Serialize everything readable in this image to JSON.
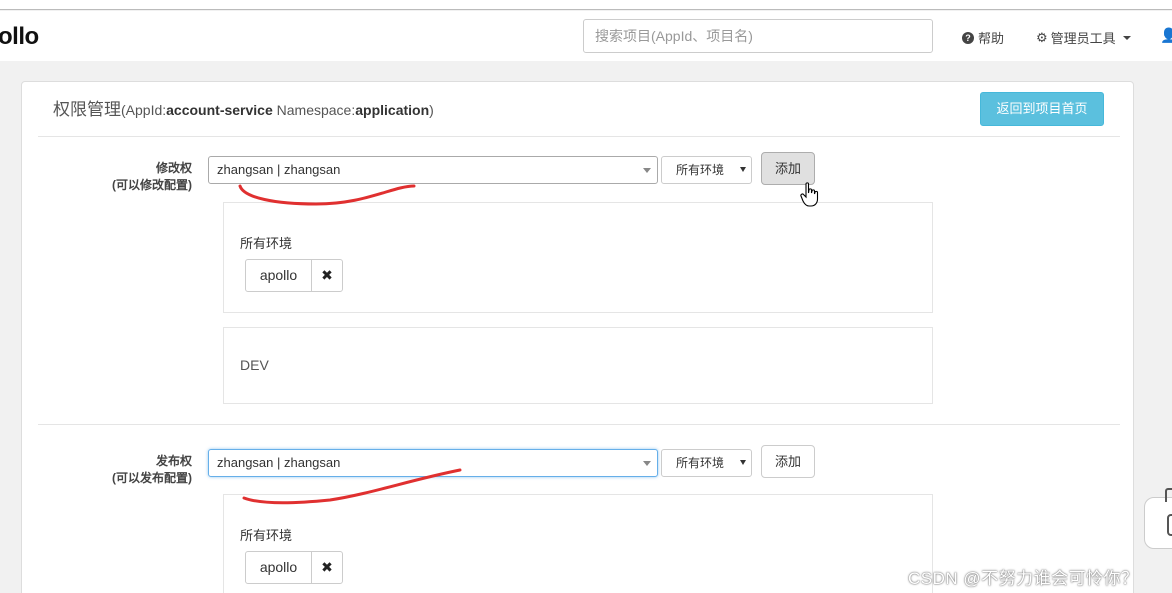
{
  "header": {
    "logo_text": "ollo",
    "search_placeholder": "搜索项目(AppId、项目名)",
    "help_label": "帮助",
    "admin_tools_label": "管理员工具",
    "help_icon_glyph": "?",
    "admin_icon_glyph": "⚙",
    "user_icon_glyph": "👤"
  },
  "page": {
    "title": "权限管理",
    "appid_label": "(AppId:",
    "appid_value": "account-service",
    "namespace_label": "Namespace:",
    "namespace_value": "application",
    "close_paren": ")",
    "back_button": "返回到项目首页"
  },
  "modify_section": {
    "label": "修改权",
    "sublabel": "(可以修改配置)",
    "user_select_value": "zhangsan | zhangsan",
    "env_select_value": "所有环境",
    "add_button": "添加",
    "env_groups": [
      {
        "env": "所有环境",
        "users": [
          "apollo"
        ]
      },
      {
        "env": "DEV",
        "users": []
      }
    ]
  },
  "release_section": {
    "label": "发布权",
    "sublabel": "(可以发布配置)",
    "user_select_value": "zhangsan | zhangsan",
    "env_select_value": "所有环境",
    "add_button": "添加",
    "env_groups": [
      {
        "env": "所有环境",
        "users": [
          "apollo"
        ]
      }
    ]
  },
  "chip_remove_glyph": "✖",
  "watermark": "CSDN @不努力谁会可怜你？",
  "colors": {
    "accent_button": "#5bc0de",
    "annotation_red": "#e03030",
    "focus_border": "#66afe9"
  }
}
